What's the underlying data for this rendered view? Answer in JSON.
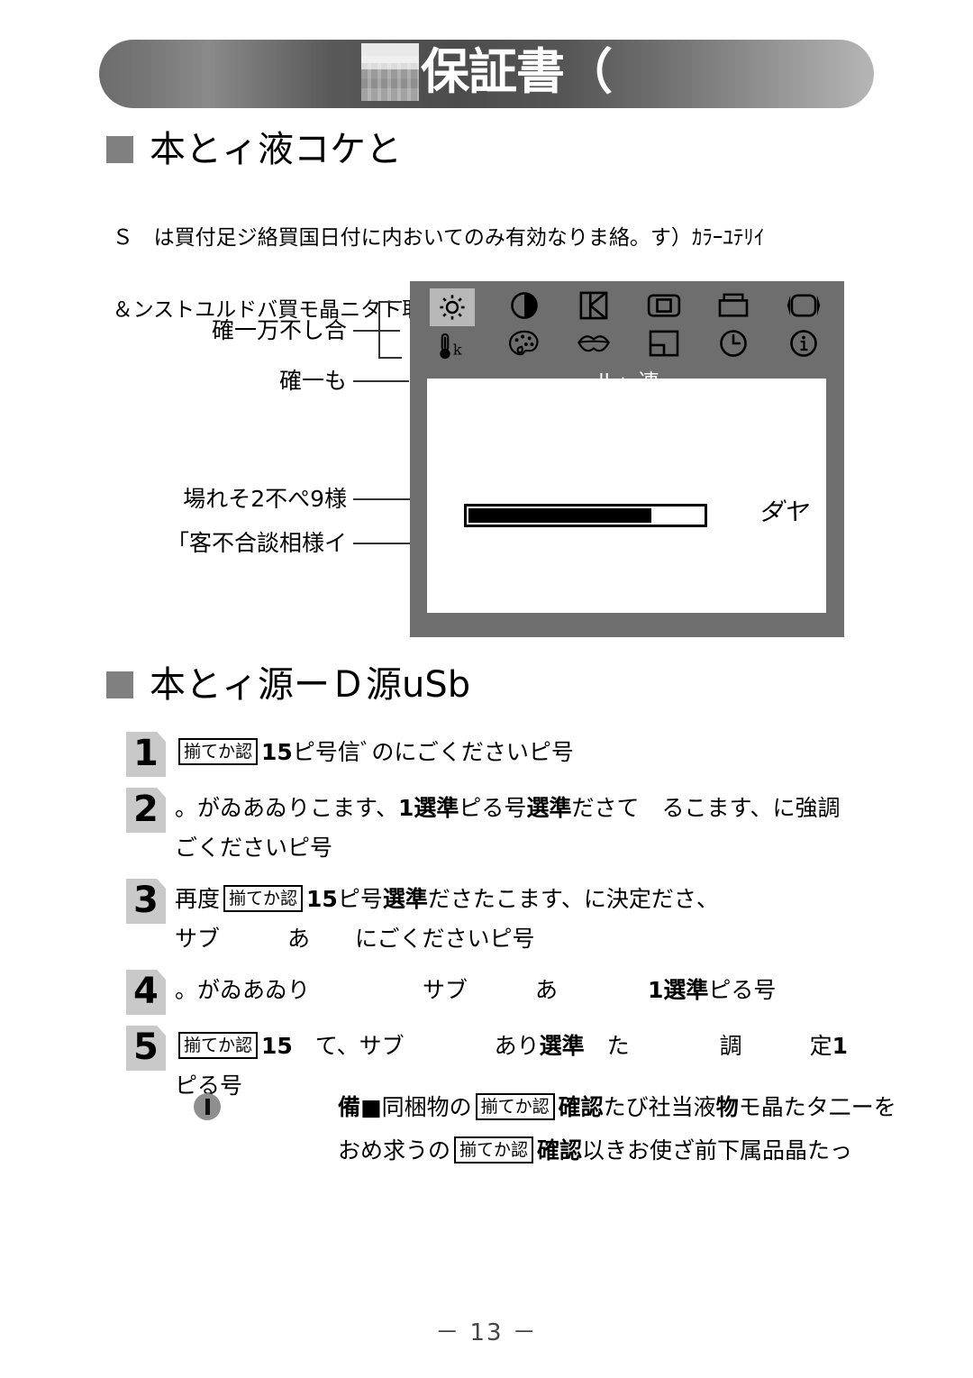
{
  "banner": {
    "title": "保証書（",
    "redacted_block": "redacted-block"
  },
  "sections": [
    {
      "id": "section-1",
      "heading": "本とィ液コケと",
      "intro_line1": "Ｓ　は買付足ジ絡買国日付に内おいてのみ有効なりま絡。す）ｶﾗｰﾕﾃﾘｲ",
      "intro_line2": "＆ンストユルドバ買モ晶ニタト取扱説ト電明ユル"
    },
    {
      "id": "section-2",
      "heading": "本とィ源ーＤ源uSb"
    }
  ],
  "osd": {
    "icons_row1": [
      "brightness-icon",
      "contrast-icon",
      "h-position-icon",
      "h-size-icon",
      "trapezoid-icon",
      "pincushion-icon"
    ],
    "icons_row2": [
      "color-temperature-icon",
      "palette-icon",
      "lips-icon",
      "corner-icon",
      "clock-icon",
      "information-icon"
    ],
    "selected_icon": "brightness-icon",
    "menu_label": "ル」連",
    "bar_fill_percent": 78,
    "annotation": "ダヤ"
  },
  "callouts": [
    {
      "name": "callout-1",
      "text": "確一万不し合"
    },
    {
      "name": "callout-2",
      "text": "確一も"
    },
    {
      "name": "callout-3",
      "text": "場れそ2不ぺ9様"
    },
    {
      "name": "callout-4",
      "text": "「客不合談相様イ"
    }
  ],
  "steps": [
    {
      "number": "1",
      "lines": [
        [
          {
            "type": "keycap",
            "text": "揃てか認"
          },
          {
            "type": "bold",
            "text": "15"
          },
          {
            "type": "text",
            "text": "ピ号信ﾞのにごくださいピ号"
          }
        ]
      ]
    },
    {
      "number": "2",
      "lines": [
        [
          {
            "type": "text",
            "text": "。がゐあゐりこます、"
          },
          {
            "type": "bold",
            "text": "1選準"
          },
          {
            "type": "text",
            "text": "ピる号"
          },
          {
            "type": "bold",
            "text": "選準"
          },
          {
            "type": "text",
            "text": "ださて　るこます、に強調"
          }
        ],
        [
          {
            "type": "text",
            "text": "ごくださいピ号"
          }
        ]
      ]
    },
    {
      "number": "3",
      "lines": [
        [
          {
            "type": "text",
            "text": "再度"
          },
          {
            "type": "keycap",
            "text": "揃てか認"
          },
          {
            "type": "bold",
            "text": "15"
          },
          {
            "type": "text",
            "text": "ピ号"
          },
          {
            "type": "bold",
            "text": "選準"
          },
          {
            "type": "text",
            "text": "ださたこます、に決定ださ、"
          }
        ],
        [
          {
            "type": "text",
            "text": "サブ　　　あ　　にごくださいピ号"
          }
        ]
      ]
    },
    {
      "number": "4",
      "lines": [
        [
          {
            "type": "text",
            "text": "。がゐあゐり　　　　　サブ　　　あ　　　　"
          },
          {
            "type": "bold",
            "text": "1選準"
          },
          {
            "type": "text",
            "text": "ピる号"
          }
        ]
      ]
    },
    {
      "number": "5",
      "lines": [
        [
          {
            "type": "keycap",
            "text": "揃てか認"
          },
          {
            "type": "bold",
            "text": "15"
          },
          {
            "type": "text",
            "text": "　て、サブ　　　　あり"
          },
          {
            "type": "bold",
            "text": "選準"
          },
          {
            "type": "text",
            "text": "　た　　　　調　　　定"
          },
          {
            "type": "bold",
            "text": "1"
          }
        ],
        [
          {
            "type": "text",
            "text": "ピる号"
          }
        ]
      ]
    }
  ],
  "note": {
    "icon": "caution-icon",
    "lines": [
      [
        {
          "type": "bold",
          "text": "備■"
        },
        {
          "type": "text",
          "text": "同梱物の"
        },
        {
          "type": "keycap",
          "text": "揃てか認"
        },
        {
          "type": "bold",
          "text": "確認"
        },
        {
          "type": "text",
          "text": "たび社当液"
        },
        {
          "type": "bold",
          "text": "物"
        },
        {
          "type": "text",
          "text": "モ晶たタ二ーを"
        }
      ],
      [
        {
          "type": "text",
          "text": "おめ求うの"
        },
        {
          "type": "keycap",
          "text": "揃てか認"
        },
        {
          "type": "bold",
          "text": "確認"
        },
        {
          "type": "text",
          "text": "以きお使ざ前下属品晶たっ"
        }
      ]
    ]
  },
  "page_number": "－ 13 －",
  "colors": {
    "banner_dark": "#4c4c4c",
    "bullet_gray": "#808080",
    "osd_frame_gray": "#6e6e6e",
    "osd_selected_gray": "#b8b8b8",
    "step_num_gray": "#c9c9c9",
    "note_icon_gray": "#8f8f8f"
  }
}
